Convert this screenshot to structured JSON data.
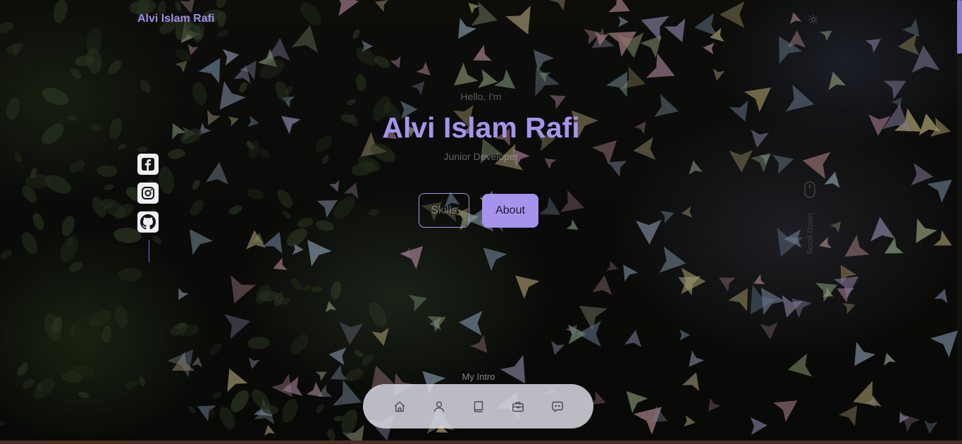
{
  "header": {
    "brand": "Alvi Islam Rafi",
    "theme_icon": "sun-icon"
  },
  "social": [
    {
      "name": "facebook",
      "icon": "facebook-icon"
    },
    {
      "name": "instagram",
      "icon": "instagram-icon"
    },
    {
      "name": "github",
      "icon": "github-icon"
    }
  ],
  "hero": {
    "greeting": "Hello, I'm",
    "name": "Alvi Islam Rafi",
    "role": "Junior Developer",
    "skills_label": "Skills",
    "about_label": "About"
  },
  "scroll_hint": {
    "icon": "mouse-icon",
    "label": "Scroll Down"
  },
  "section_label": "My Intro",
  "bottom_nav": [
    {
      "name": "home",
      "icon": "home-icon"
    },
    {
      "name": "about",
      "icon": "user-icon"
    },
    {
      "name": "skills",
      "icon": "book-icon"
    },
    {
      "name": "portfolio",
      "icon": "briefcase-icon"
    },
    {
      "name": "contact",
      "icon": "chat-icon"
    }
  ],
  "colors": {
    "accent": "#a694ec",
    "button_fill": "#a593ec",
    "nav_background": "#dadae4",
    "icon_tile": "#efeff3"
  }
}
